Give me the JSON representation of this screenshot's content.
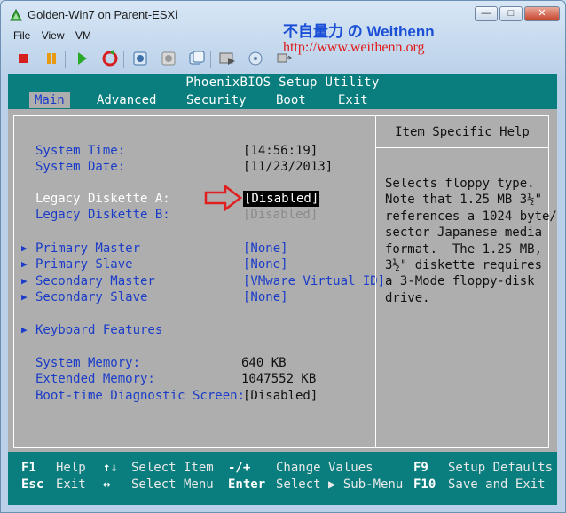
{
  "window": {
    "title": "Golden-Win7 on Parent-ESXi",
    "controls": {
      "minimize": "—",
      "maximize": "□",
      "close": "✕"
    }
  },
  "watermark": {
    "title": "不自量力 の Weithenn",
    "url": "http://www.weithenn.org"
  },
  "menu": {
    "file": "File",
    "view": "View",
    "vm": "VM"
  },
  "toolbar": [
    {
      "icon": "stop-icon"
    },
    {
      "icon": "pause-icon"
    },
    {
      "icon": "play-icon"
    },
    {
      "icon": "reset-icon"
    },
    {
      "icon": "snapshot-icon"
    },
    {
      "icon": "revert-snapshot-icon"
    },
    {
      "icon": "manage-snapshots-icon"
    },
    {
      "icon": "console-options-icon"
    },
    {
      "icon": "cd-device-icon"
    },
    {
      "icon": "network-device-icon"
    }
  ],
  "bios": {
    "title": "PhoenixBIOS Setup Utility",
    "tabs": [
      {
        "label": "Main",
        "active": true
      },
      {
        "label": "Advanced"
      },
      {
        "label": "Security"
      },
      {
        "label": "Boot"
      },
      {
        "label": "Exit"
      }
    ],
    "fields": {
      "system_time_label": "System Time:",
      "system_time_value": "[14:56:19]",
      "system_date_label": "System Date:",
      "system_date_value": "[11/23/2013]",
      "legacy_a_label": "Legacy Diskette A:",
      "legacy_a_value": "[Disabled]",
      "legacy_b_label": "Legacy Diskette B:",
      "legacy_b_value": "[Disabled]",
      "primary_master_label": "Primary Master",
      "primary_master_value": "[None]",
      "primary_slave_label": "Primary Slave",
      "primary_slave_value": "[None]",
      "secondary_master_label": "Secondary Master",
      "secondary_master_value": "[VMware Virtual ID]",
      "secondary_slave_label": "Secondary Slave",
      "secondary_slave_value": "[None]",
      "keyboard_features_label": "Keyboard Features",
      "system_memory_label": "System Memory:",
      "system_memory_value": "640 KB",
      "extended_memory_label": "Extended Memory:",
      "extended_memory_value": "1047552 KB",
      "boot_diag_label": "Boot-time Diagnostic Screen:",
      "boot_diag_value": "[Disabled]",
      "submenu_marker": "▶"
    },
    "help": {
      "title": "Item Specific Help",
      "text": "Selects floppy type.\nNote that 1.25 MB 3½\"\nreferences a 1024 byte/\nsector Japanese media\nformat.  The 1.25 MB,\n3½\" diskette requires\na 3-Mode floppy-disk\ndrive."
    },
    "footer": {
      "f1_key": "F1",
      "f1_desc": "Help",
      "updown_key": "↑↓",
      "updown_desc": "Select Item",
      "plusminus_key": "-/+",
      "plusminus_desc": "Change Values",
      "f9_key": "F9",
      "f9_desc": "Setup Defaults",
      "esc_key": "Esc",
      "esc_desc": "Exit",
      "leftright_key": "↔",
      "leftright_desc": "Select Menu",
      "enter_key": "Enter",
      "enter_desc": "Select ▶ Sub-Menu",
      "f10_key": "F10",
      "f10_desc": "Save and Exit"
    }
  },
  "colors": {
    "bios_teal": "#0a7e7e",
    "bios_grey": "#aeaeae",
    "bios_blue_text": "#1a3cc8",
    "annotation_red": "#e02020"
  }
}
